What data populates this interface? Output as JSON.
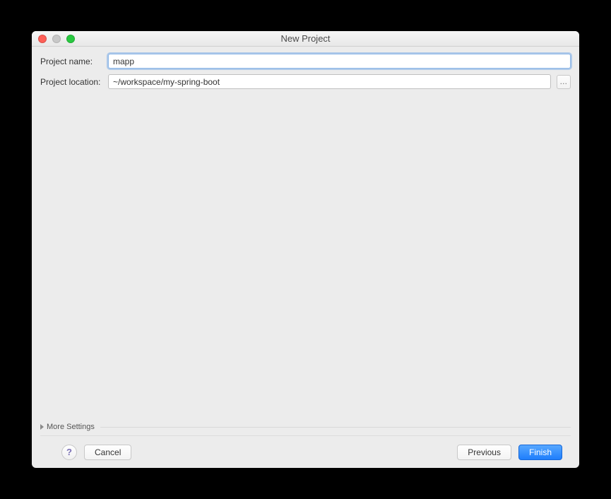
{
  "window": {
    "title": "New Project"
  },
  "form": {
    "projectNameLabel": "Project name:",
    "projectNameValue": "mapp",
    "projectLocationLabel": "Project location:",
    "projectLocationValue": "~/workspace/my-spring-boot",
    "browseLabel": "…"
  },
  "moreSettings": {
    "label": "More Settings"
  },
  "footer": {
    "helpLabel": "?",
    "cancelLabel": "Cancel",
    "previousLabel": "Previous",
    "finishLabel": "Finish"
  }
}
